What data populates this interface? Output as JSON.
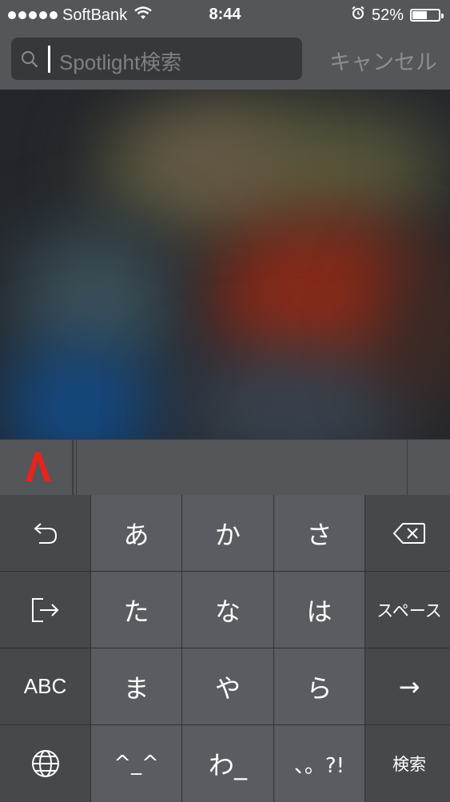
{
  "status_bar": {
    "carrier": "SoftBank",
    "time": "8:44",
    "battery_percent_text": "52%",
    "battery_level": 0.52
  },
  "search": {
    "placeholder": "Spotlight検索",
    "cancel_label": "キャンセル"
  },
  "keyboard": {
    "rows": [
      [
        "undo-icon",
        "あ",
        "か",
        "さ",
        "delete-icon"
      ],
      [
        "next-icon",
        "た",
        "な",
        "は",
        "スペース"
      ],
      [
        "ABC",
        "ま",
        "や",
        "ら",
        "→"
      ],
      [
        "globe-icon",
        "^_^",
        "わ_",
        "、。?!",
        "検索"
      ]
    ]
  },
  "colors": {
    "statusbar_bg": "#545659",
    "keyboard_dark": "#46484c",
    "keyboard_light": "#5a5c61",
    "logo_red": "#e8231c"
  }
}
